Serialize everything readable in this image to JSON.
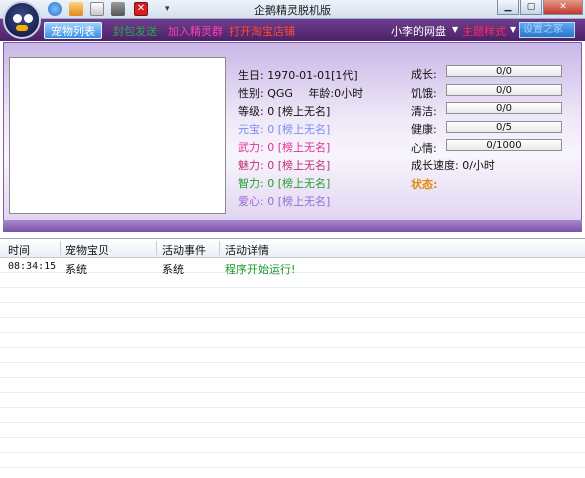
{
  "window": {
    "title": "企鹅精灵脱机版"
  },
  "menu": {
    "tab_active": "宠物列表",
    "items": [
      {
        "label": "封包发送",
        "color": "#2aa84a"
      },
      {
        "label": "加入精灵群",
        "color": "#ff3fb0"
      },
      {
        "label": "打开淘宝店铺",
        "color": "#ff4a2a"
      }
    ],
    "right_items": [
      {
        "label": "小李的网盘",
        "color": "#ffffff",
        "dropdown": true
      },
      {
        "label": "主题样式",
        "color": "#ff2a60",
        "dropdown": true
      }
    ],
    "selected_value": "设置之家"
  },
  "pet": {
    "birthday_label": "生日:",
    "birthday_value": "1970-01-01[1代]",
    "gender_label": "性别:",
    "gender_value": "QGG",
    "age_label": "年龄:",
    "age_value": "0小时",
    "attrs": [
      {
        "label": "等级:",
        "value": "0 [榜上无名]",
        "color": "#111111"
      },
      {
        "label": "元宝:",
        "value": "0 [榜上无名]",
        "color": "#7b8cf0"
      },
      {
        "label": "武力:",
        "value": "0 [榜上无名]",
        "color": "#e0309a"
      },
      {
        "label": "魅力:",
        "value": "0 [榜上无名]",
        "color": "#c03070"
      },
      {
        "label": "智力:",
        "value": "0 [榜上无名]",
        "color": "#20a030"
      },
      {
        "label": "爱心:",
        "value": "0 [榜上无名]",
        "color": "#9a6ad8"
      }
    ]
  },
  "stats": [
    {
      "label": "成长:",
      "value": "0/0"
    },
    {
      "label": "饥饿:",
      "value": "0/0"
    },
    {
      "label": "清洁:",
      "value": "0/0"
    },
    {
      "label": "健康:",
      "value": "0/5"
    },
    {
      "label": "心情:",
      "value": "0/1000"
    }
  ],
  "growth_speed_label": "成长速度:",
  "growth_speed_value": "0/小时",
  "status_label": "状态:",
  "log": {
    "columns": [
      "时间",
      "宠物宝贝",
      "活动事件",
      "活动详情"
    ],
    "rows": [
      {
        "time": "08:34:15",
        "pet": "系统",
        "event": "系统",
        "detail": "程序开始运行!"
      }
    ]
  }
}
